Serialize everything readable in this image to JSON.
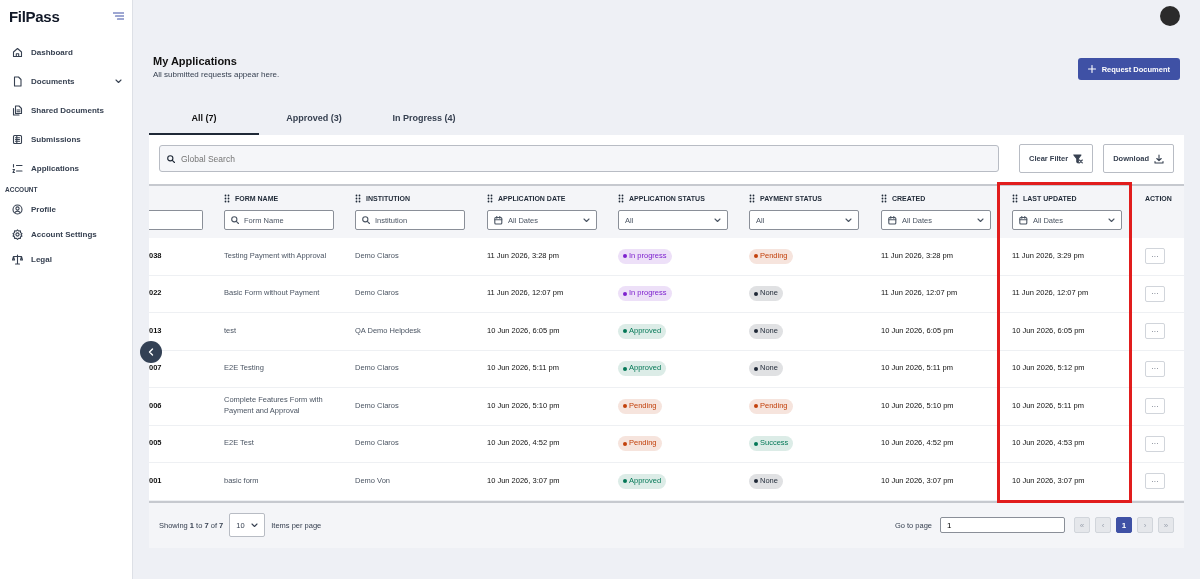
{
  "brand": {
    "name": "FilPass"
  },
  "sidebar": {
    "items": [
      {
        "label": "Dashboard"
      },
      {
        "label": "Documents",
        "expandable": true
      },
      {
        "label": "Shared Documents"
      },
      {
        "label": "Submissions"
      },
      {
        "label": "Applications"
      }
    ],
    "section": "ACCOUNT",
    "account_items": [
      {
        "label": "Profile"
      },
      {
        "label": "Account Settings"
      },
      {
        "label": "Legal"
      }
    ]
  },
  "page": {
    "title": "My Applications",
    "subtitle": "All submitted requests appear here.",
    "action": "Request Document"
  },
  "tabs": [
    {
      "label": "All (7)",
      "selected": true
    },
    {
      "label": "Approved (3)",
      "selected": false
    },
    {
      "label": "In Progress (4)",
      "selected": false
    }
  ],
  "search": {
    "placeholder": "Global Search"
  },
  "toolbar": {
    "clear": "Clear Filter",
    "download": "Download"
  },
  "table": {
    "columns": [
      {
        "filter": {
          "kind": "text"
        },
        "highlighted": false
      },
      {
        "label": "FORM NAME",
        "filter": {
          "kind": "text",
          "placeholder": "Form Name"
        },
        "highlighted": false
      },
      {
        "label": "INSTITUTION",
        "filter": {
          "kind": "text",
          "placeholder": "Institution"
        },
        "highlighted": false
      },
      {
        "label": "APPLICATION DATE",
        "filter": {
          "kind": "date",
          "value": "All Dates"
        },
        "highlighted": false
      },
      {
        "label": "APPLICATION STATUS",
        "filter": {
          "kind": "select",
          "value": "All"
        },
        "highlighted": false
      },
      {
        "label": "PAYMENT STATUS",
        "filter": {
          "kind": "select",
          "value": "All"
        },
        "highlighted": false
      },
      {
        "label": "CREATED",
        "filter": {
          "kind": "date",
          "value": "All Dates"
        },
        "highlighted": false
      },
      {
        "label": "LAST UPDATED",
        "filter": {
          "kind": "date",
          "value": "All Dates"
        },
        "highlighted": true
      },
      {
        "label": "ACTION",
        "highlighted": false
      }
    ],
    "rows": [
      {
        "column_1": "038",
        "form_name": "Testing Payment with Approval",
        "institution": "Demo Claros",
        "application_date": "11 Jun 2026, 3:28 pm",
        "application_status": {
          "label": "In progress",
          "color": "#7e22ce"
        },
        "payment_status": {
          "label": "Pending",
          "color": "#c2410c"
        },
        "created": "11 Jun 2026, 3:28 pm",
        "last_updated": "11 Jun 2026, 3:29 pm",
        "action": "···"
      },
      {
        "column_1": "022",
        "form_name": "Basic Form without Payment",
        "institution": "Demo Claros",
        "application_date": "11 Jun 2026, 12:07 pm",
        "application_status": {
          "label": "In progress",
          "color": "#7e22ce"
        },
        "payment_status": {
          "label": "None",
          "color": "#1f2937"
        },
        "created": "11 Jun 2026, 12:07 pm",
        "last_updated": "11 Jun 2026, 12:07 pm",
        "action": "···"
      },
      {
        "column_1": "013",
        "form_name": "test",
        "institution": "QA Demo Helpdesk",
        "application_date": "10 Jun 2026, 6:05 pm",
        "application_status": {
          "label": "Approved",
          "color": "#047857"
        },
        "payment_status": {
          "label": "None",
          "color": "#1f2937"
        },
        "created": "10 Jun 2026, 6:05 pm",
        "last_updated": "10 Jun 2026, 6:05 pm",
        "action": "···"
      },
      {
        "column_1": "007",
        "form_name": "E2E Testing",
        "institution": "Demo Claros",
        "application_date": "10 Jun 2026, 5:11 pm",
        "application_status": {
          "label": "Approved",
          "color": "#047857"
        },
        "payment_status": {
          "label": "None",
          "color": "#1f2937"
        },
        "created": "10 Jun 2026, 5:11 pm",
        "last_updated": "10 Jun 2026, 5:12 pm",
        "action": "···"
      },
      {
        "column_1": "006",
        "form_name": "Complete Features Form with Payment and Approval",
        "institution": "Demo Claros",
        "application_date": "10 Jun 2026, 5:10 pm",
        "application_status": {
          "label": "Pending",
          "color": "#c2410c"
        },
        "payment_status": {
          "label": "Pending",
          "color": "#c2410c"
        },
        "created": "10 Jun 2026, 5:10 pm",
        "last_updated": "10 Jun 2026, 5:11 pm",
        "action": "···"
      },
      {
        "column_1": "005",
        "form_name": "E2E Test",
        "institution": "Demo Claros",
        "application_date": "10 Jun 2026, 4:52 pm",
        "application_status": {
          "label": "Pending",
          "color": "#c2410c"
        },
        "payment_status": {
          "label": "Success",
          "color": "#047857"
        },
        "created": "10 Jun 2026, 4:52 pm",
        "last_updated": "10 Jun 2026, 4:53 pm",
        "action": "···"
      },
      {
        "column_1": "001",
        "form_name": "basic form",
        "institution": "Demo Von",
        "application_date": "10 Jun 2026, 3:07 pm",
        "application_status": {
          "label": "Approved",
          "color": "#047857"
        },
        "payment_status": {
          "label": "None",
          "color": "#1f2937"
        },
        "created": "10 Jun 2026, 3:07 pm",
        "last_updated": "10 Jun 2026, 3:07 pm",
        "action": "···"
      }
    ]
  },
  "footer": {
    "showing": "Showing **1** to **7** of **7**",
    "per_page": "10",
    "per_page_label": "Items per page",
    "goto_label": "Go to page",
    "goto_value": "1",
    "pages": [
      {
        "label": "«",
        "selected": false
      },
      {
        "label": "‹",
        "selected": false
      },
      {
        "label": "1",
        "selected": true
      },
      {
        "label": "›",
        "selected": false
      },
      {
        "label": "»",
        "selected": false
      }
    ]
  }
}
